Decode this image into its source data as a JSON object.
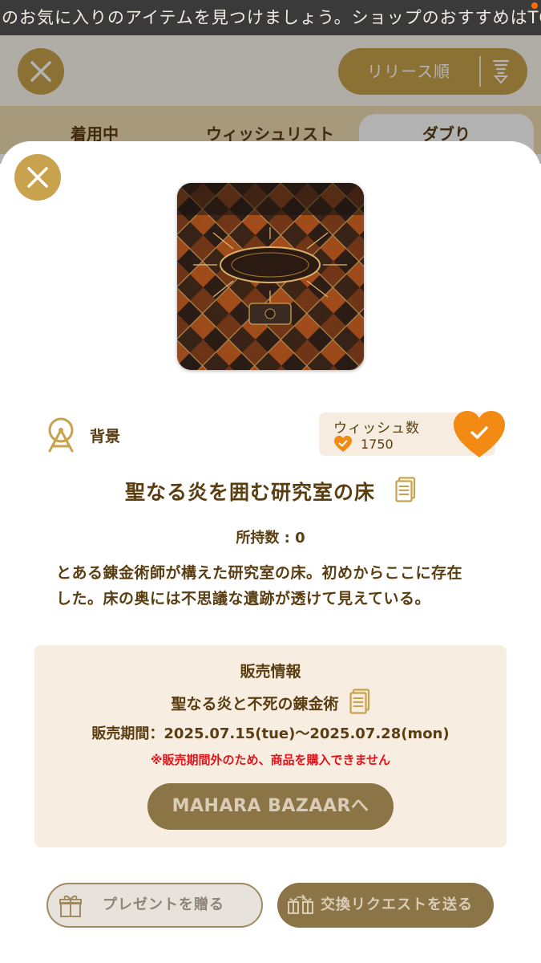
{
  "ticker": {
    "text": "のお気に入りのアイテムを見つけましょう。ショップのおすすめはTO"
  },
  "header": {
    "sort_label": "リリース順"
  },
  "tabs": [
    {
      "label": "着用中",
      "active": false
    },
    {
      "label": "ウィッシュリスト",
      "active": false
    },
    {
      "label": "ダブり",
      "active": true
    }
  ],
  "item": {
    "category": "背景",
    "category_icon": "ferris-wheel-icon",
    "wish_title": "ウィッシュ数",
    "wish_count": "1750",
    "wished": true,
    "name": "聖なる炎を囲む研究室の床",
    "owned": "所持数 : 0",
    "description": "とある錬金術師が構えた研究室の床。初めからここに存在した。床の奥には不思議な遺跡が透けて見えている。"
  },
  "sale": {
    "title": "販売情報",
    "event": "聖なる炎と不死の錬金術",
    "period": "販売期間：2025.07.15(tue)〜2025.07.28(mon)",
    "warning": "※販売期間外のため、商品を購入できません",
    "bazaar_button": "MAHARA BAZAARへ"
  },
  "actions": {
    "gift_label": "プレゼントを贈る",
    "trade_label": "交換リクエストを送る"
  },
  "colors": {
    "gold": "#c9a24d",
    "brown_text": "#5a3e12",
    "accent_orange": "#f28a14",
    "warning_red": "#e2141b",
    "disabled_button": "#8b7446"
  }
}
